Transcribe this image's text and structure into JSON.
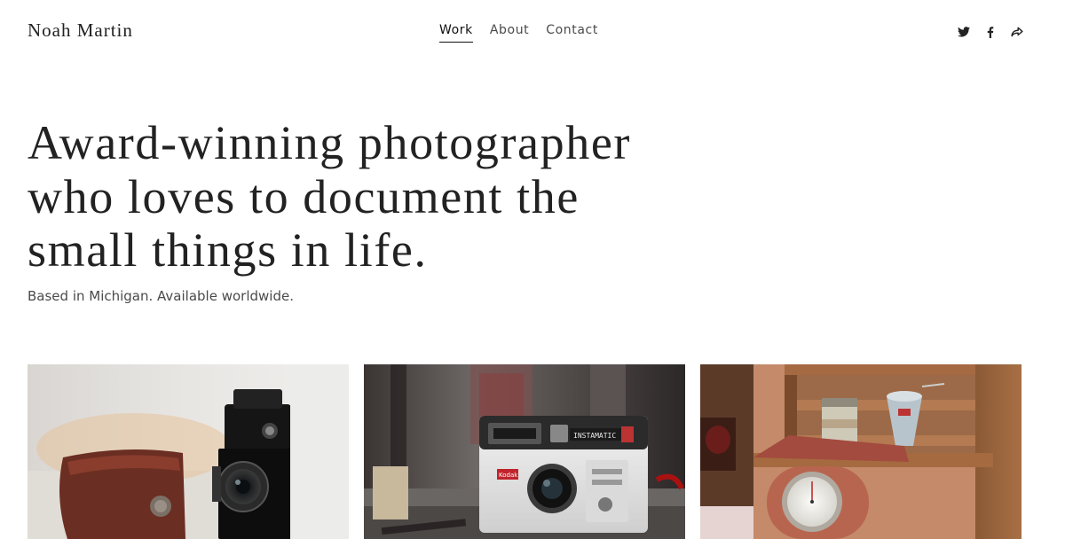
{
  "header": {
    "site_title": "Noah Martin",
    "nav": [
      {
        "label": "Work",
        "active": true
      },
      {
        "label": "About",
        "active": false
      },
      {
        "label": "Contact",
        "active": false
      }
    ],
    "social_icons": [
      "twitter-icon",
      "facebook-icon",
      "share-icon"
    ]
  },
  "hero": {
    "headline": "Award-winning photographer who loves to document the small things in life.",
    "headline_lines": [
      "Award-winning photographer",
      "who loves to document the",
      "small things in life."
    ],
    "subtitle": "Based in Michigan. Available worldwide."
  },
  "gallery": {
    "photos": [
      {
        "subject": "vintage-folding-camera"
      },
      {
        "subject": "kodak-instamatic-camera"
      },
      {
        "subject": "vintage-kitchen-scale"
      }
    ]
  },
  "colors": {
    "text": "#222222",
    "nav_inactive": "#4a4a4a",
    "background": "#ffffff"
  }
}
